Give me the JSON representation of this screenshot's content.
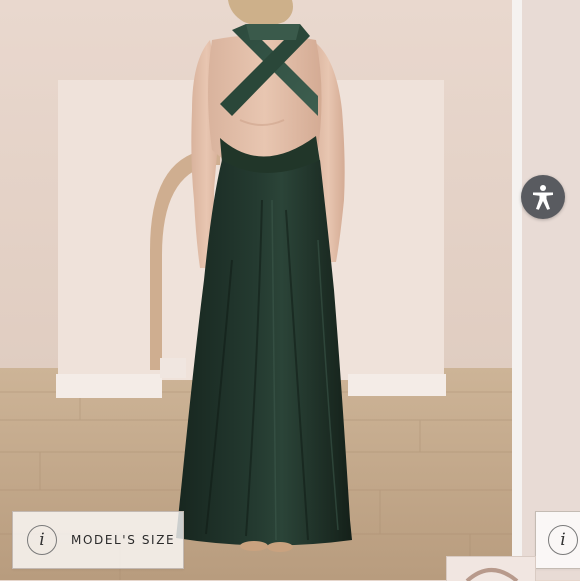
{
  "model_size_badge": {
    "label": "MODEL'S SIZE",
    "icon": "info-icon",
    "glyph": "i"
  },
  "accessibility_button": {
    "icon": "accessibility-person-icon",
    "color": "#595b60"
  },
  "colors": {
    "dress": "#1f3329",
    "wall": "#e6d6cc",
    "floor": "#c2a88a"
  }
}
